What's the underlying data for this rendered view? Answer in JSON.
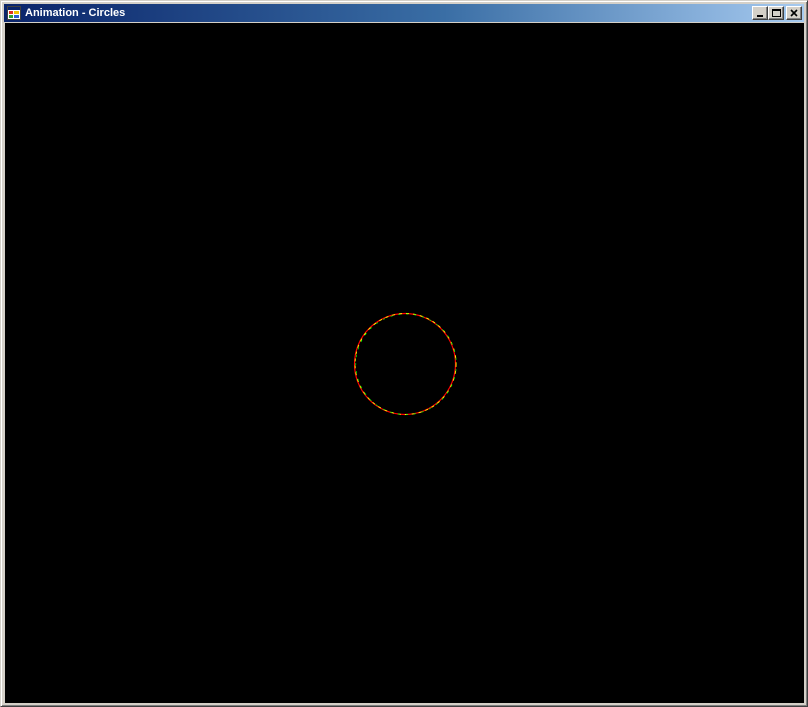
{
  "window": {
    "title": "Animation - Circles",
    "icon": "app-window-icon"
  },
  "caption_buttons": [
    {
      "name": "minimize-button",
      "icon": "minimize-icon"
    },
    {
      "name": "maximize-button",
      "icon": "maximize-icon"
    },
    {
      "name": "close-button",
      "icon": "close-icon"
    }
  ],
  "canvas": {
    "background": "#000000",
    "circle_colors": [
      "#ff0000",
      "#ffff00",
      "#00ff00"
    ]
  }
}
